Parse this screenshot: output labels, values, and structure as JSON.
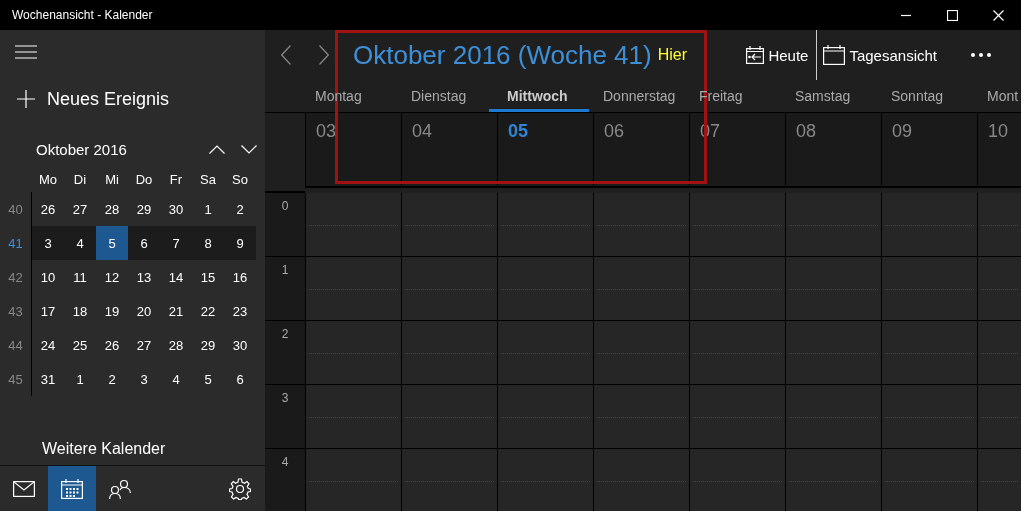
{
  "window": {
    "title": "Wochenansicht - Kalender"
  },
  "sidebar": {
    "new_event": "Neues Ereignis",
    "mini_calendar": {
      "month": "Oktober 2016",
      "weekdays": [
        "Mo",
        "Di",
        "Mi",
        "Do",
        "Fr",
        "Sa",
        "So"
      ],
      "weeks": [
        {
          "number": "40",
          "selected": false,
          "days": [
            {
              "label": "26",
              "selected": false
            },
            {
              "label": "27",
              "selected": false
            },
            {
              "label": "28",
              "selected": false
            },
            {
              "label": "29",
              "selected": false
            },
            {
              "label": "30",
              "selected": false
            },
            {
              "label": "1",
              "selected": false
            },
            {
              "label": "2",
              "selected": false
            }
          ]
        },
        {
          "number": "41",
          "selected": true,
          "days": [
            {
              "label": "3",
              "selected": false
            },
            {
              "label": "4",
              "selected": false
            },
            {
              "label": "5",
              "selected": true
            },
            {
              "label": "6",
              "selected": false
            },
            {
              "label": "7",
              "selected": false
            },
            {
              "label": "8",
              "selected": false
            },
            {
              "label": "9",
              "selected": false
            }
          ]
        },
        {
          "number": "42",
          "selected": false,
          "days": [
            {
              "label": "10",
              "selected": false
            },
            {
              "label": "11",
              "selected": false
            },
            {
              "label": "12",
              "selected": false
            },
            {
              "label": "13",
              "selected": false
            },
            {
              "label": "14",
              "selected": false
            },
            {
              "label": "15",
              "selected": false
            },
            {
              "label": "16",
              "selected": false
            }
          ]
        },
        {
          "number": "43",
          "selected": false,
          "days": [
            {
              "label": "17",
              "selected": false
            },
            {
              "label": "18",
              "selected": false
            },
            {
              "label": "19",
              "selected": false
            },
            {
              "label": "20",
              "selected": false
            },
            {
              "label": "21",
              "selected": false
            },
            {
              "label": "22",
              "selected": false
            },
            {
              "label": "23",
              "selected": false
            }
          ]
        },
        {
          "number": "44",
          "selected": false,
          "days": [
            {
              "label": "24",
              "selected": false
            },
            {
              "label": "25",
              "selected": false
            },
            {
              "label": "26",
              "selected": false
            },
            {
              "label": "27",
              "selected": false
            },
            {
              "label": "28",
              "selected": false
            },
            {
              "label": "29",
              "selected": false
            },
            {
              "label": "30",
              "selected": false
            }
          ]
        },
        {
          "number": "45",
          "selected": false,
          "days": [
            {
              "label": "31",
              "selected": false
            },
            {
              "label": "1",
              "selected": false
            },
            {
              "label": "2",
              "selected": false
            },
            {
              "label": "3",
              "selected": false
            },
            {
              "label": "4",
              "selected": false
            },
            {
              "label": "5",
              "selected": false
            },
            {
              "label": "6",
              "selected": false
            }
          ]
        }
      ]
    },
    "more_calendars": "Weitere Kalender",
    "bottom_nav": [
      {
        "kind": "mail",
        "selected": false
      },
      {
        "kind": "calendar",
        "selected": true
      },
      {
        "kind": "people",
        "selected": false
      },
      {
        "kind": "settings",
        "selected": false
      }
    ]
  },
  "header": {
    "title": "Oktober 2016 (Woche 41)",
    "annotation": {
      "label": "Hier",
      "frame": true
    },
    "toolbar": [
      {
        "kind": "today",
        "label": "Heute"
      },
      {
        "kind": "day-view",
        "label": "Tagesansicht"
      },
      {
        "kind": "more"
      }
    ]
  },
  "days": [
    {
      "name": "Montag",
      "date": "03",
      "selected": false
    },
    {
      "name": "Dienstag",
      "date": "04",
      "selected": false
    },
    {
      "name": "Mittwoch",
      "date": "05",
      "selected": true
    },
    {
      "name": "Donnerstag",
      "date": "06",
      "selected": false
    },
    {
      "name": "Freitag",
      "date": "07",
      "selected": false
    },
    {
      "name": "Samstag",
      "date": "08",
      "selected": false
    },
    {
      "name": "Sonntag",
      "date": "09",
      "selected": false
    },
    {
      "name": "Mont",
      "date": "10",
      "selected": false
    }
  ],
  "hours": [
    "0",
    "1",
    "2",
    "3",
    "4"
  ]
}
